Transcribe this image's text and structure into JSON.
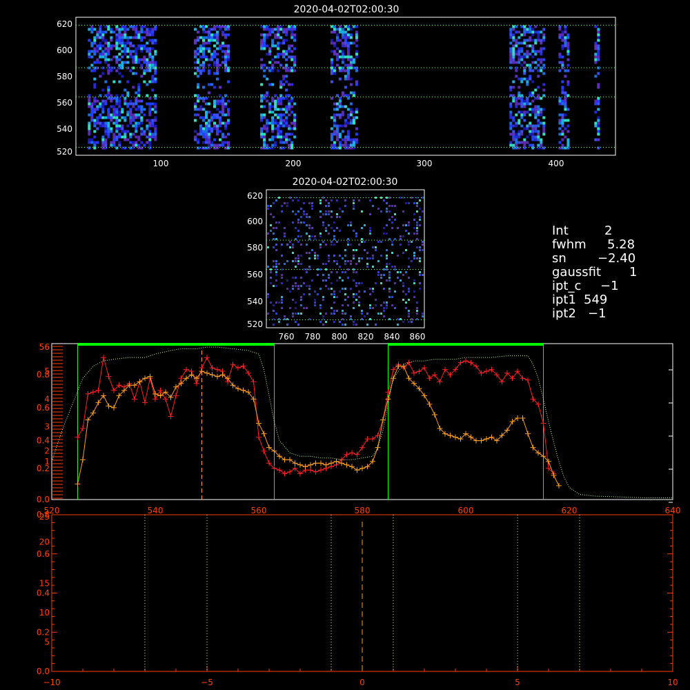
{
  "panel1": {
    "title": "2020-04-02T02:00:30",
    "xticks": [
      "100",
      "200",
      "300",
      "400"
    ],
    "yticks": [
      "520",
      "540",
      "560",
      "580",
      "600",
      "620"
    ]
  },
  "panel2": {
    "title": "2020-04-02T02:00:30",
    "xticks": [
      "760",
      "780",
      "800",
      "820",
      "840",
      "860"
    ],
    "yticks": [
      "520",
      "540",
      "560",
      "580",
      "600",
      "620"
    ]
  },
  "info": [
    {
      "key": "Int",
      "value": "2"
    },
    {
      "key": "fwhm",
      "value": "5.28"
    },
    {
      "key": "sn",
      "value": "−2.40"
    },
    {
      "key": "gaussfit",
      "value": "1"
    },
    {
      "key": "ipt_c",
      "value": "−1"
    },
    {
      "key": "ipt1",
      "value": "549"
    },
    {
      "key": "ipt2",
      "value": "−1"
    }
  ],
  "colors": {
    "red": "#ff2020",
    "orange": "#ffa020",
    "green": "#00ff00",
    "lightgreen": "#ccff99",
    "axis_orange": "#ff4000"
  },
  "chart_data": [
    {
      "type": "heatmap",
      "title": "2020-04-02T02:00:30",
      "xlim": [
        33,
        440
      ],
      "ylim": [
        519,
        623
      ],
      "bright_x_bands": [
        [
          42,
          92
        ],
        [
          122,
          148
        ],
        [
          172,
          198
        ],
        [
          225,
          245
        ],
        [
          360,
          385
        ],
        [
          397,
          404
        ],
        [
          424,
          428
        ]
      ],
      "guide_rows": [
        525,
        563,
        585,
        617
      ]
    },
    {
      "type": "heatmap",
      "title": "2020-04-02T02:00:30",
      "xlim": [
        746,
        864
      ],
      "ylim": [
        519,
        623
      ],
      "guide_rows": [
        525,
        563,
        585,
        617
      ]
    },
    {
      "type": "line",
      "xlim": [
        520,
        640
      ],
      "ylim": [
        0,
        0.9
      ],
      "xticks": [
        "520",
        "540",
        "560",
        "580",
        "600",
        "620",
        "640"
      ],
      "yticks_left": [
        {
          "v": 0.0,
          "t": "0.0"
        },
        {
          "v": 0.18,
          "t": "0.2"
        },
        {
          "v": 0.22,
          "t": "1"
        },
        {
          "v": 0.34,
          "t": "0.4"
        },
        {
          "v": 0.28,
          "t": "2"
        },
        {
          "v": 0.42,
          "t": "3"
        },
        {
          "v": 0.53,
          "t": "0.6"
        },
        {
          "v": 0.58,
          "t": "4"
        },
        {
          "v": 0.74,
          "t": "5"
        },
        {
          "v": 0.72,
          "t": "0.8"
        },
        {
          "v": 0.88,
          "t": "56"
        }
      ],
      "fit_windows": [
        [
          525,
          563
        ],
        [
          585,
          615
        ]
      ],
      "marker_x": 549,
      "series": [
        {
          "color": "#ff2020",
          "x": [
            525,
            526,
            527,
            528,
            529,
            530,
            531,
            532,
            533,
            534,
            535,
            536,
            537,
            538,
            539,
            540,
            541,
            542,
            543,
            544,
            545,
            546,
            547,
            548,
            549,
            550,
            551,
            552,
            553,
            554,
            555,
            556,
            557,
            558,
            559,
            560,
            561,
            562,
            563,
            564,
            565,
            566,
            567,
            568,
            569,
            570,
            571,
            572,
            573,
            574,
            575,
            576,
            577,
            578,
            579,
            580,
            581,
            582,
            583,
            584,
            585,
            586,
            587,
            588,
            589,
            590,
            591,
            592,
            593,
            594,
            595,
            596,
            597,
            598,
            599,
            600,
            601,
            602,
            603,
            604,
            605,
            606,
            607,
            608,
            609,
            610,
            611,
            612,
            613,
            614,
            615,
            616,
            617
          ],
          "y": [
            0.36,
            0.41,
            0.61,
            0.62,
            0.63,
            0.82,
            0.71,
            0.63,
            0.66,
            0.65,
            0.67,
            0.58,
            0.68,
            0.56,
            0.7,
            0.58,
            0.63,
            0.58,
            0.48,
            0.6,
            0.7,
            0.75,
            0.74,
            0.67,
            0.76,
            0.82,
            0.76,
            0.75,
            0.74,
            0.68,
            0.78,
            0.76,
            0.77,
            0.73,
            0.68,
            0.36,
            0.28,
            0.21,
            0.18,
            0.17,
            0.15,
            0.16,
            0.18,
            0.15,
            0.17,
            0.17,
            0.16,
            0.17,
            0.18,
            0.19,
            0.2,
            0.23,
            0.26,
            0.27,
            0.26,
            0.3,
            0.35,
            0.35,
            0.37,
            0.46,
            0.62,
            0.75,
            0.78,
            0.76,
            0.79,
            0.73,
            0.74,
            0.76,
            0.7,
            0.72,
            0.68,
            0.75,
            0.72,
            0.75,
            0.79,
            0.8,
            0.79,
            0.77,
            0.73,
            0.74,
            0.75,
            0.72,
            0.68,
            0.73,
            0.7,
            0.74,
            0.7,
            0.69,
            0.58,
            0.55,
            0.44,
            0.18,
            0.15
          ]
        },
        {
          "color": "#ffa020",
          "x": [
            525,
            526,
            527,
            528,
            529,
            530,
            531,
            532,
            533,
            534,
            535,
            536,
            537,
            538,
            539,
            540,
            541,
            542,
            543,
            544,
            545,
            546,
            547,
            548,
            549,
            550,
            551,
            552,
            553,
            554,
            555,
            556,
            557,
            558,
            559,
            560,
            561,
            562,
            563,
            564,
            565,
            566,
            567,
            568,
            569,
            570,
            571,
            572,
            573,
            574,
            575,
            576,
            577,
            578,
            579,
            580,
            581,
            582,
            583,
            584,
            585,
            586,
            587,
            588,
            589,
            590,
            591,
            592,
            593,
            594,
            595,
            596,
            597,
            598,
            599,
            600,
            601,
            602,
            603,
            604,
            605,
            606,
            607,
            608,
            609,
            610,
            611,
            612,
            613,
            614,
            615,
            616,
            617,
            618
          ],
          "y": [
            0.09,
            0.23,
            0.46,
            0.5,
            0.56,
            0.6,
            0.54,
            0.53,
            0.6,
            0.63,
            0.66,
            0.66,
            0.68,
            0.7,
            0.71,
            0.61,
            0.6,
            0.62,
            0.59,
            0.65,
            0.67,
            0.7,
            0.72,
            0.7,
            0.74,
            0.73,
            0.72,
            0.71,
            0.72,
            0.7,
            0.66,
            0.64,
            0.63,
            0.62,
            0.58,
            0.44,
            0.38,
            0.3,
            0.28,
            0.25,
            0.23,
            0.23,
            0.21,
            0.2,
            0.19,
            0.2,
            0.21,
            0.21,
            0.2,
            0.21,
            0.22,
            0.21,
            0.2,
            0.19,
            0.17,
            0.18,
            0.19,
            0.22,
            0.3,
            0.46,
            0.58,
            0.7,
            0.77,
            0.77,
            0.7,
            0.67,
            0.64,
            0.6,
            0.55,
            0.49,
            0.41,
            0.38,
            0.37,
            0.36,
            0.35,
            0.38,
            0.36,
            0.34,
            0.34,
            0.35,
            0.36,
            0.34,
            0.37,
            0.4,
            0.45,
            0.47,
            0.47,
            0.38,
            0.3,
            0.27,
            0.25,
            0.22,
            0.14,
            0.08
          ]
        },
        {
          "color": "#ccff99",
          "x": [
            520,
            522,
            524,
            526,
            528,
            530,
            532,
            535,
            538,
            540,
            543,
            545,
            548,
            550,
            552,
            555,
            558,
            560,
            561,
            562,
            563,
            564,
            566,
            568,
            570,
            572,
            574,
            576,
            578,
            580,
            582,
            583,
            584,
            585,
            586,
            588,
            590,
            592,
            594,
            596,
            598,
            600,
            602,
            605,
            608,
            610,
            612,
            613,
            614,
            615,
            616,
            617,
            618,
            619,
            620,
            622,
            625,
            630,
            635,
            640
          ],
          "y": [
            0.22,
            0.4,
            0.55,
            0.7,
            0.77,
            0.8,
            0.81,
            0.82,
            0.82,
            0.84,
            0.86,
            0.87,
            0.87,
            0.88,
            0.88,
            0.87,
            0.86,
            0.84,
            0.75,
            0.6,
            0.45,
            0.34,
            0.27,
            0.25,
            0.25,
            0.24,
            0.24,
            0.23,
            0.23,
            0.24,
            0.25,
            0.3,
            0.4,
            0.55,
            0.7,
            0.78,
            0.8,
            0.8,
            0.81,
            0.81,
            0.81,
            0.82,
            0.82,
            0.82,
            0.83,
            0.83,
            0.83,
            0.78,
            0.7,
            0.58,
            0.45,
            0.33,
            0.22,
            0.13,
            0.07,
            0.03,
            0.02,
            0.015,
            0.01,
            0.01
          ]
        }
      ]
    },
    {
      "type": "line",
      "xlim": [
        -10,
        10
      ],
      "ylim": [
        0,
        0.8
      ],
      "xticks": [
        "−10",
        "−5",
        "0",
        "5",
        "10"
      ],
      "yticks_left": [
        {
          "v": 0.0,
          "t": "0.0"
        },
        {
          "v": 0.2,
          "t": "0.2"
        },
        {
          "v": 0.4,
          "t": "0.4"
        },
        {
          "v": 0.6,
          "t": "0.6"
        },
        {
          "v": 0.8,
          "t": "0.8"
        },
        {
          "v": 0.15,
          "t": "5"
        },
        {
          "v": 0.3,
          "t": "10"
        },
        {
          "v": 0.45,
          "t": "15"
        },
        {
          "v": 0.66,
          "t": "20"
        },
        {
          "v": 0.79,
          "t": "25"
        }
      ],
      "vlines_dotted": [
        -7,
        -5,
        -1,
        1,
        5,
        7
      ],
      "vline_dashed": 0,
      "series": []
    }
  ]
}
